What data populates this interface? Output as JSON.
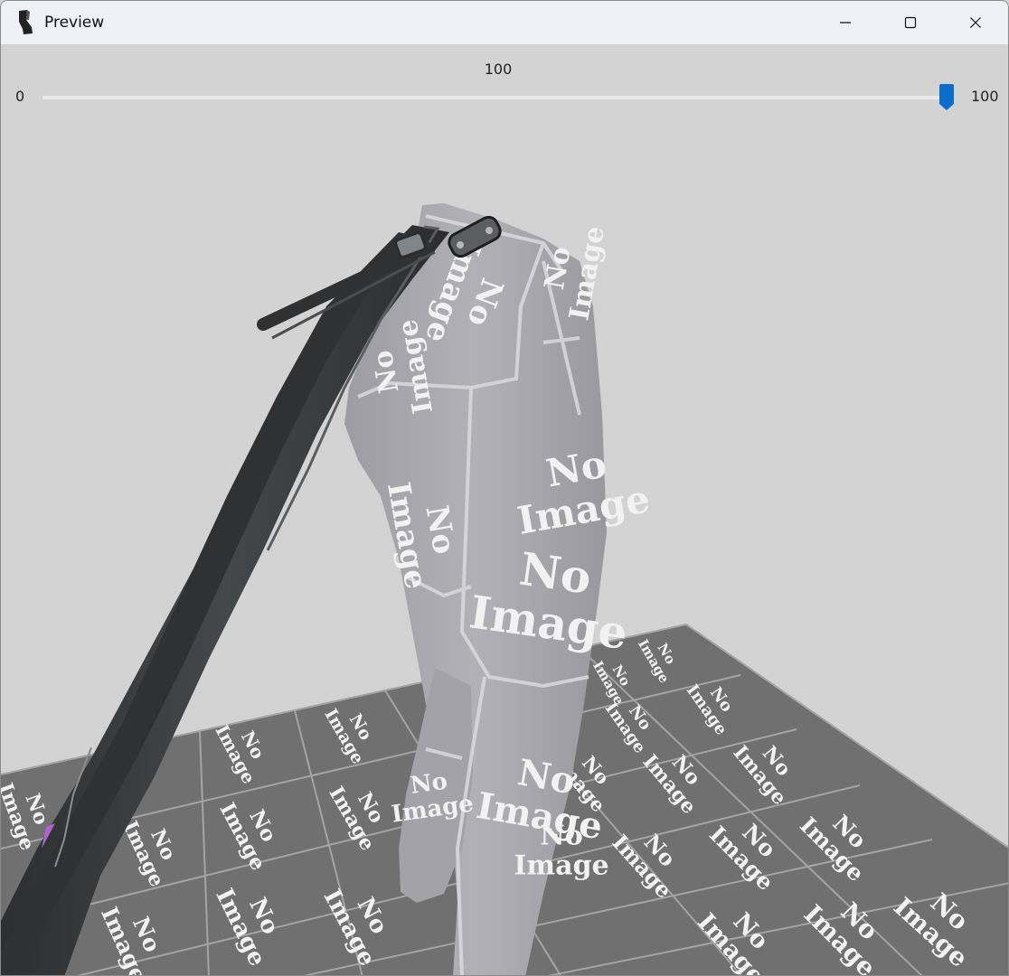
{
  "window": {
    "title": "Preview",
    "icon": "boot-icon",
    "controls": [
      "minimize-icon",
      "maximize-icon",
      "close-icon"
    ]
  },
  "slider": {
    "value_label": "100",
    "min_label": "0",
    "max_label": "100",
    "value": 100,
    "min": 0,
    "max": 100,
    "accent_color": "#0a6ccc"
  },
  "viewport": {
    "background_color": "#d3d3d3",
    "placeholder_texture_line1": "No",
    "placeholder_texture_line2": "Image",
    "floor_color": "#6f6f6f",
    "model_color": "#a8a8ad",
    "strap_color": "#3a3c3e"
  }
}
